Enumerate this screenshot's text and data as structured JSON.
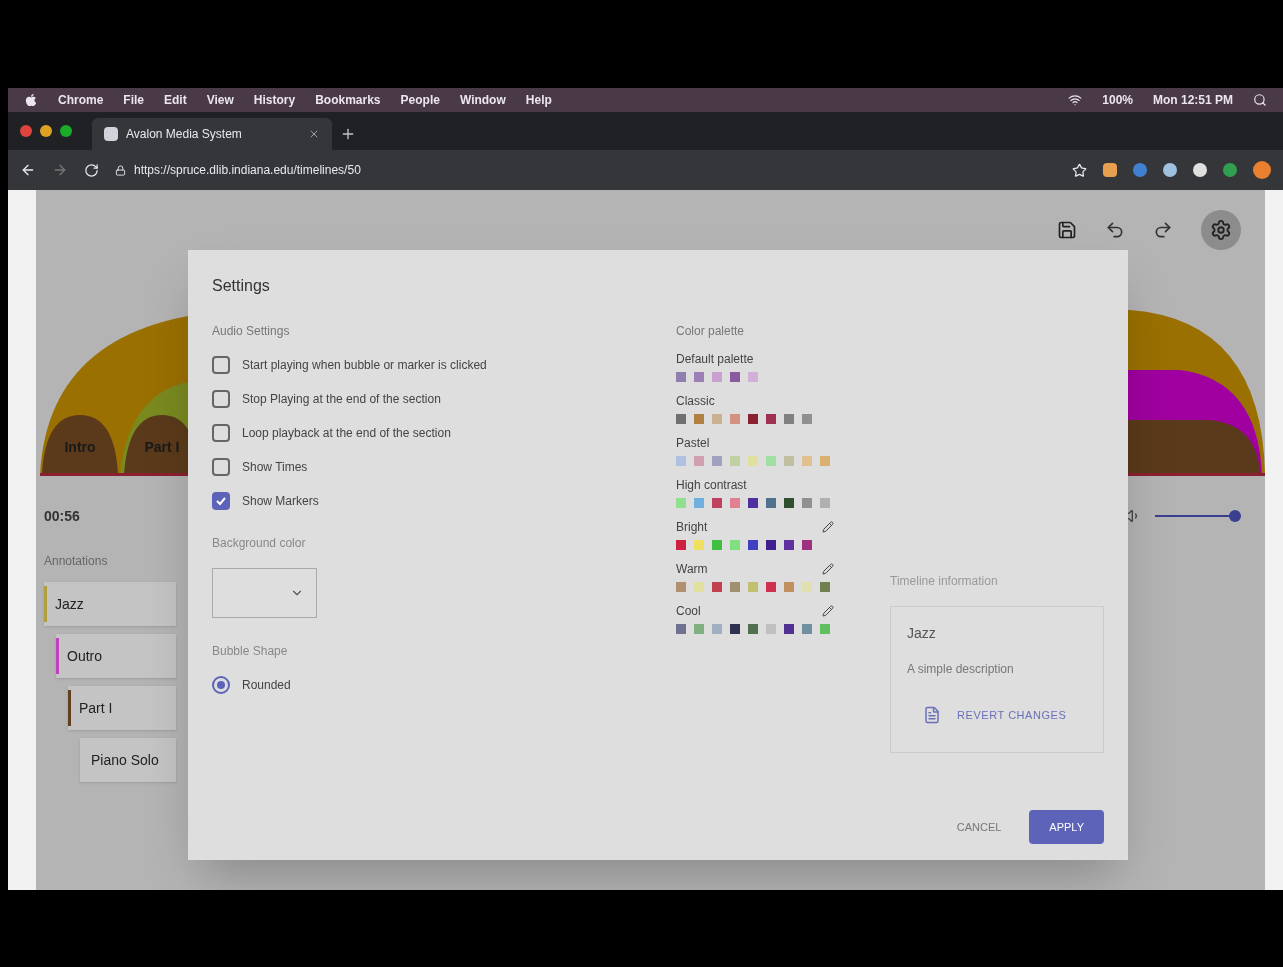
{
  "menu_bar": {
    "app": "Chrome",
    "items": [
      "File",
      "Edit",
      "View",
      "History",
      "Bookmarks",
      "People",
      "Window",
      "Help"
    ],
    "battery": "100%",
    "clock": "Mon 12:51 PM"
  },
  "tab": {
    "title": "Avalon Media System"
  },
  "address_bar": {
    "url": "https://spruce.dlib.indiana.edu/timelines/50"
  },
  "timeline": {
    "arcs": [
      {
        "label": "Intro"
      },
      {
        "label": "Part I"
      }
    ]
  },
  "player": {
    "time": "00:56",
    "volume": {
      "level": 1
    }
  },
  "annotations": {
    "title": "Annotations",
    "items": [
      {
        "label": "Jazz",
        "color": "#b0a040",
        "children": [
          {
            "label": "Outro",
            "color": "#c040c0",
            "children": [
              {
                "label": "Part I",
                "color": "#604020",
                "children": [
                  {
                    "label": "Piano Solo"
                  }
                ]
              }
            ]
          }
        ]
      }
    ]
  },
  "settings_dialog": {
    "title": "Settings",
    "audio_settings": {
      "title": "Audio Settings",
      "options": [
        {
          "label": "Start playing when bubble or marker is clicked",
          "checked": false
        },
        {
          "label": "Stop Playing at the end of the section",
          "checked": false
        },
        {
          "label": "Loop playback at the end of the section",
          "checked": false
        },
        {
          "label": "Show Times",
          "checked": false
        },
        {
          "label": "Show Markers",
          "checked": true
        }
      ]
    },
    "background_color": {
      "label": "Background color"
    },
    "bubble_shape": {
      "label": "Bubble Shape",
      "options": [
        {
          "label": "Rounded",
          "selected": true
        }
      ]
    },
    "color_palette": {
      "title": "Color palette",
      "palettes": [
        {
          "name": "Default palette",
          "editable": false,
          "swatches": [
            {
              "color": "#8f80b0"
            },
            {
              "color": "#9b7fb5"
            },
            {
              "color": "#c9a0d0"
            },
            {
              "color": "#8a5aa0"
            },
            {
              "color": "#d0b0d8"
            }
          ]
        },
        {
          "name": "Classic",
          "editable": false,
          "swatches": [
            {
              "color": "#707070"
            },
            {
              "color": "#b08040"
            },
            {
              "color": "#c8b090"
            },
            {
              "color": "#d49080"
            },
            {
              "color": "#8a2030"
            },
            {
              "color": "#a03050"
            },
            {
              "color": "#808080"
            },
            {
              "color": "#909090"
            }
          ]
        },
        {
          "name": "Pastel",
          "editable": false,
          "swatches": [
            {
              "color": "#b0c0e0"
            },
            {
              "color": "#d0a0b0"
            },
            {
              "color": "#a0a0c0"
            },
            {
              "color": "#c0d0a0"
            },
            {
              "color": "#e0e0a0"
            },
            {
              "color": "#a0e0a0"
            },
            {
              "color": "#c0c0a0"
            },
            {
              "color": "#e0c090"
            },
            {
              "color": "#d8b070"
            }
          ]
        },
        {
          "name": "High contrast",
          "editable": false,
          "swatches": [
            {
              "color": "#90e090"
            },
            {
              "color": "#70b0e0"
            },
            {
              "color": "#c04060"
            },
            {
              "color": "#e08090"
            },
            {
              "color": "#5030a0"
            },
            {
              "color": "#507090"
            },
            {
              "color": "#305030"
            },
            {
              "color": "#909090"
            },
            {
              "color": "#b0b0b0"
            }
          ]
        },
        {
          "name": "Bright",
          "editable": true,
          "swatches": [
            {
              "color": "#d02040"
            },
            {
              "color": "#f0e060"
            },
            {
              "color": "#40c040"
            },
            {
              "color": "#80e080"
            },
            {
              "color": "#4040c0"
            },
            {
              "color": "#402090"
            },
            {
              "color": "#6030a0"
            },
            {
              "color": "#a03080"
            }
          ]
        },
        {
          "name": "Warm",
          "editable": true,
          "swatches": [
            {
              "color": "#b09070"
            },
            {
              "color": "#e0e0a0"
            },
            {
              "color": "#c04050"
            },
            {
              "color": "#a09070"
            },
            {
              "color": "#c0c070"
            },
            {
              "color": "#d03050"
            },
            {
              "color": "#c09060"
            },
            {
              "color": "#e0e0b0"
            },
            {
              "color": "#708050"
            }
          ]
        },
        {
          "name": "Cool",
          "editable": true,
          "swatches": [
            {
              "color": "#707090"
            },
            {
              "color": "#80b080"
            },
            {
              "color": "#a0b0c0"
            },
            {
              "color": "#303050"
            },
            {
              "color": "#507050"
            },
            {
              "color": "#c0c0c0"
            },
            {
              "color": "#503090"
            },
            {
              "color": "#7090a0"
            },
            {
              "color": "#60c060"
            }
          ]
        }
      ]
    },
    "timeline_info": {
      "title": "Timeline information",
      "name": "Jazz",
      "description": "A simple description",
      "revert_button": "REVERT CHANGES"
    },
    "buttons": [
      {
        "label": "CANCEL",
        "kind": "text"
      },
      {
        "label": "APPLY",
        "kind": "primary"
      }
    ]
  }
}
